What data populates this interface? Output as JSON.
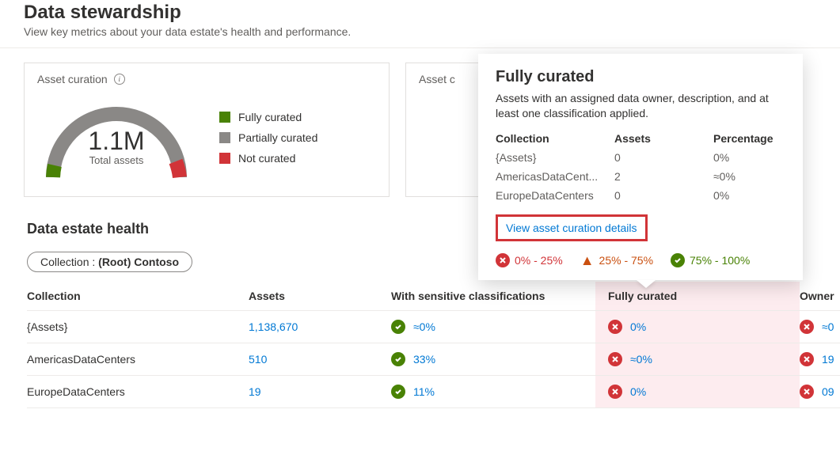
{
  "header": {
    "title": "Data stewardship",
    "subtitle": "View key metrics about your data estate's health and performance."
  },
  "colors": {
    "green": "#498205",
    "gray": "#8a8886",
    "red": "#d13438",
    "orange": "#ca5010",
    "link": "#0078d4"
  },
  "curation_card": {
    "title": "Asset curation",
    "total_value": "1.1M",
    "total_label": "Total assets",
    "legend": {
      "full": "Fully curated",
      "partial": "Partially curated",
      "none": "Not curated"
    }
  },
  "chart_data": {
    "type": "pie",
    "title": "Asset curation (semi-donut gauge)",
    "total": 1100000,
    "series": [
      {
        "name": "Fully curated",
        "color": "#498205",
        "fraction_approx": 0.02
      },
      {
        "name": "Partially curated",
        "color": "#8a8886",
        "fraction_approx": 0.9
      },
      {
        "name": "Not curated",
        "color": "#d13438",
        "fraction_approx": 0.08
      }
    ],
    "note": "Rendered as a 180° gauge; left→right = fully→partially→not curated"
  },
  "curation_card2": {
    "title_visible": "Asset c"
  },
  "popover": {
    "title": "Fully curated",
    "desc": "Assets with an assigned data owner, description, and at least one classification applied.",
    "headers": {
      "col": "Collection",
      "assets": "Assets",
      "pct": "Percentage"
    },
    "rows": [
      {
        "collection": "{Assets}",
        "assets": "0",
        "pct": "0%"
      },
      {
        "collection": "AmericasDataCent...",
        "assets": "2",
        "pct": "≈0%"
      },
      {
        "collection": "EuropeDataCenters",
        "assets": "0",
        "pct": "0%"
      }
    ],
    "link": "View asset curation details",
    "legend": {
      "low": "0% - 25%",
      "mid": "25% - 75%",
      "high": "75% - 100%"
    }
  },
  "health": {
    "title": "Data estate health",
    "filter_label": "Collection :",
    "filter_value": "(Root) Contoso",
    "columns": {
      "collection": "Collection",
      "assets": "Assets",
      "sensitive": "With sensitive classifications",
      "curated": "Fully curated",
      "owner": "Owner"
    },
    "rows": [
      {
        "collection": "{Assets}",
        "assets": "1,138,670",
        "sensitive": "≈0%",
        "sens_status": "green",
        "curated": "0%",
        "cur_status": "red",
        "owner": "≈0",
        "own_status": "red"
      },
      {
        "collection": "AmericasDataCenters",
        "assets": "510",
        "sensitive": "33%",
        "sens_status": "green",
        "curated": "≈0%",
        "cur_status": "red",
        "owner": "19",
        "own_status": "red"
      },
      {
        "collection": "EuropeDataCenters",
        "assets": "19",
        "sensitive": "11%",
        "sens_status": "green",
        "curated": "0%",
        "cur_status": "red",
        "owner": "09",
        "own_status": "red"
      }
    ]
  }
}
